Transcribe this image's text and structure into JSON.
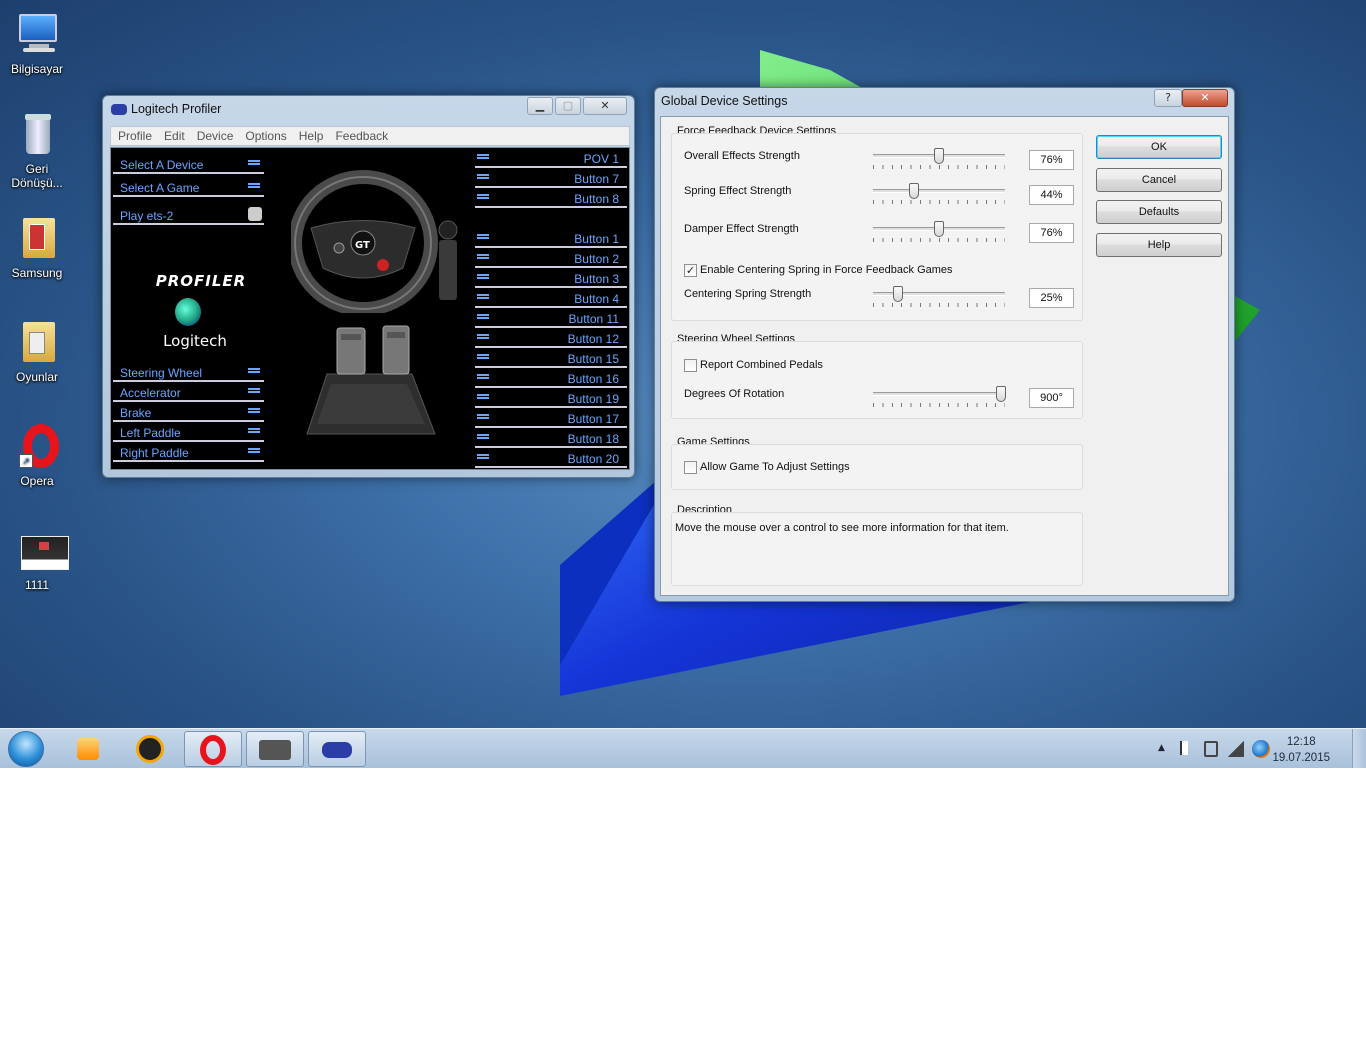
{
  "desktop": {
    "icons": [
      {
        "label": "Bilgisayar",
        "icon": "computer-icon"
      },
      {
        "label": "Geri\nDönüşü...",
        "icon": "recycle-bin-icon"
      },
      {
        "label": "Samsung",
        "icon": "folder-icon"
      },
      {
        "label": "Oyunlar",
        "icon": "folder-icon"
      },
      {
        "label": "Opera",
        "icon": "opera-icon"
      },
      {
        "label": "1111",
        "icon": "image-file-icon"
      }
    ]
  },
  "profiler": {
    "title": "Logitech Profiler",
    "menu": [
      "Profile",
      "Edit",
      "Device",
      "Options",
      "Help",
      "Feedback"
    ],
    "left_top": [
      "Select A Device",
      "Select A Game",
      "Play ets-2"
    ],
    "brand": {
      "profiler": "PROFILER",
      "logitech": "Logitech"
    },
    "left_bottom": [
      "Steering Wheel",
      "Accelerator",
      "Brake",
      "Left Paddle",
      "Right Paddle"
    ],
    "right_top": [
      "POV 1",
      "Button 7",
      "Button 8"
    ],
    "right_bottom": [
      "Button 1",
      "Button 2",
      "Button 3",
      "Button 4",
      "Button 11",
      "Button 12",
      "Button 15",
      "Button 16",
      "Button 19",
      "Button 17",
      "Button 18",
      "Button 20"
    ]
  },
  "gds": {
    "title": "Global Device Settings",
    "help_glyph": "?",
    "close_glyph": "✕",
    "ff_group": "Force Feedback Device Settings",
    "overall": {
      "label": "Overall Effects Strength",
      "value": "76%",
      "level": 0.5
    },
    "spring": {
      "label": "Spring Effect Strength",
      "value": "44%",
      "level": 0.31
    },
    "damper": {
      "label": "Damper Effect Strength",
      "value": "76%",
      "level": 0.5
    },
    "enable_centering": {
      "label": "Enable Centering Spring in Force Feedback Games",
      "checked": true,
      "mark": "✓"
    },
    "centering": {
      "label": "Centering Spring Strength",
      "value": "25%",
      "level": 0.19
    },
    "sw_group": "Steering Wheel Settings",
    "report_pedals": {
      "label": "Report Combined Pedals",
      "checked": false
    },
    "rotation": {
      "label": "Degrees Of Rotation",
      "value": "900°",
      "level": 0.97
    },
    "game_group": "Game Settings",
    "allow_game": {
      "label": "Allow Game To Adjust Settings",
      "checked": false
    },
    "desc_group": "Description",
    "desc_text": "Move the mouse over a control to see more information for that item.",
    "buttons": {
      "ok": "OK",
      "cancel": "Cancel",
      "defaults": "Defaults",
      "help": "Help"
    }
  },
  "taskbar": {
    "time": "12:18",
    "date": "19.07.2015",
    "items": [
      "start-orb-icon",
      "media-player-icon",
      "aimp-icon",
      "opera-icon",
      "truck-icon",
      "gamepad-icon"
    ]
  },
  "colors": {
    "accent_text": "#6aa6ff",
    "profiler_bg": "#000000",
    "dialog_bg": "#f0f0f0"
  }
}
